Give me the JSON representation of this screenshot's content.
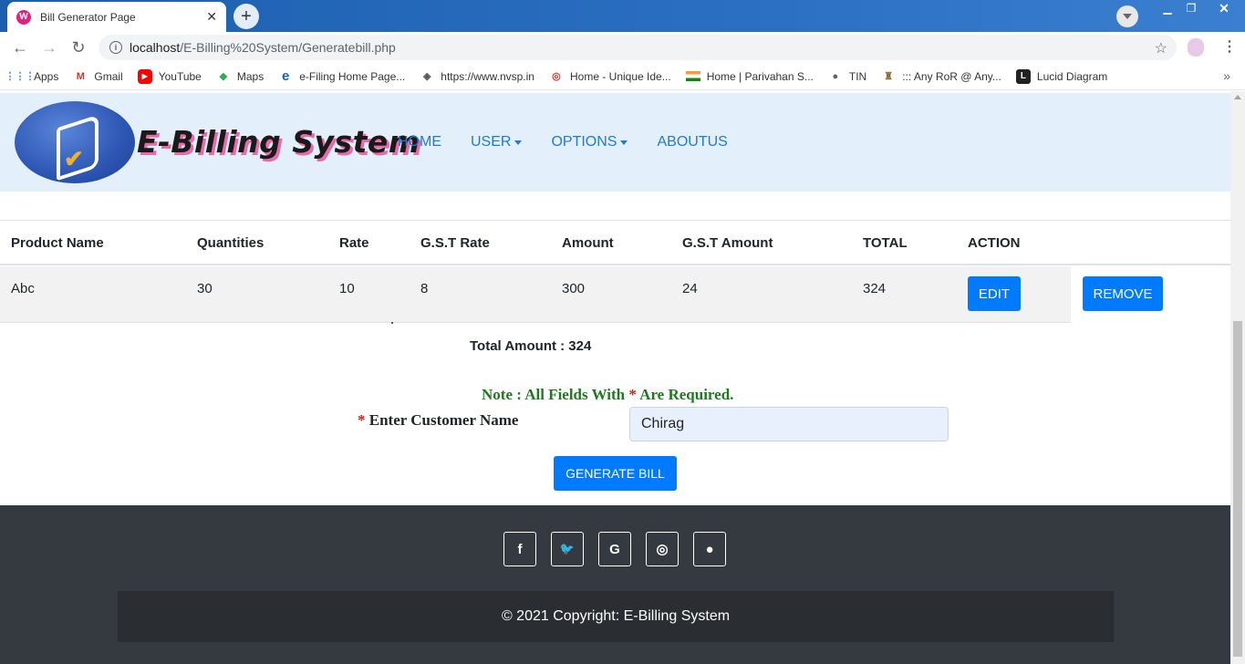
{
  "browser": {
    "tab_title": "Bill Generator Page",
    "tab_close": "✕",
    "new_tab": "+",
    "url_host": "localhost",
    "url_path": "/E-Billing%20System/Generatebill.php",
    "bookmarks": [
      {
        "label": "Apps",
        "icon": "apps-grid-icon"
      },
      {
        "label": "Gmail",
        "icon": "gmail-icon"
      },
      {
        "label": "YouTube",
        "icon": "youtube-icon"
      },
      {
        "label": "Maps",
        "icon": "maps-icon"
      },
      {
        "label": "e-Filing Home Page...",
        "icon": "efiling-icon"
      },
      {
        "label": "https://www.nvsp.in",
        "icon": "nvsp-icon"
      },
      {
        "label": "Home - Unique Ide...",
        "icon": "aadhaar-icon"
      },
      {
        "label": "Home | Parivahan S...",
        "icon": "india-flag-icon"
      },
      {
        "label": "TIN",
        "icon": "globe-icon"
      },
      {
        "label": "::: Any RoR @ Any...",
        "icon": "emblem-icon"
      },
      {
        "label": "Lucid Diagram",
        "icon": "lucid-icon"
      }
    ],
    "bookmarks_more": "»"
  },
  "navbar": {
    "brand": "E-Billing System",
    "links": [
      {
        "label": "HOME",
        "dropdown": false
      },
      {
        "label": "USER",
        "dropdown": true
      },
      {
        "label": "OPTIONS",
        "dropdown": true
      },
      {
        "label": "ABOUTUS",
        "dropdown": false
      }
    ]
  },
  "table": {
    "headers": [
      "Product Name",
      "Quantities",
      "Rate",
      "G.S.T Rate",
      "Amount",
      "G.S.T Amount",
      "TOTAL",
      "ACTION"
    ],
    "rows": [
      {
        "product": "Abc",
        "quantity": "30",
        "rate": "10",
        "gst_rate": "8",
        "amount": "300",
        "gst_amount": "24",
        "total": "324",
        "edit_label": "EDIT",
        "remove_label": "REMOVE"
      }
    ]
  },
  "summary": {
    "total_label": "Total Amount : 324"
  },
  "form": {
    "note_prefix": "Note : All Fields With ",
    "note_star": "*",
    "note_suffix": " Are Required.",
    "customer_star": "*",
    "customer_label": " Enter Customer Name",
    "customer_value": "Chirag",
    "generate_label": "GENERATE BILL"
  },
  "footer": {
    "social": [
      {
        "icon": "facebook-icon",
        "glyph": "f"
      },
      {
        "icon": "twitter-icon",
        "glyph": "🐦"
      },
      {
        "icon": "google-icon",
        "glyph": "G"
      },
      {
        "icon": "instagram-icon",
        "glyph": "◎"
      },
      {
        "icon": "github-icon",
        "glyph": "●"
      }
    ],
    "copyright": "© 2021 Copyright: E-Billing System"
  },
  "colors": {
    "primary": "#007bff",
    "navbar_bg": "#e3f0fb",
    "footer_bg": "#343a40",
    "note_green": "#1f7a1f",
    "required_red": "#d81b1b"
  }
}
